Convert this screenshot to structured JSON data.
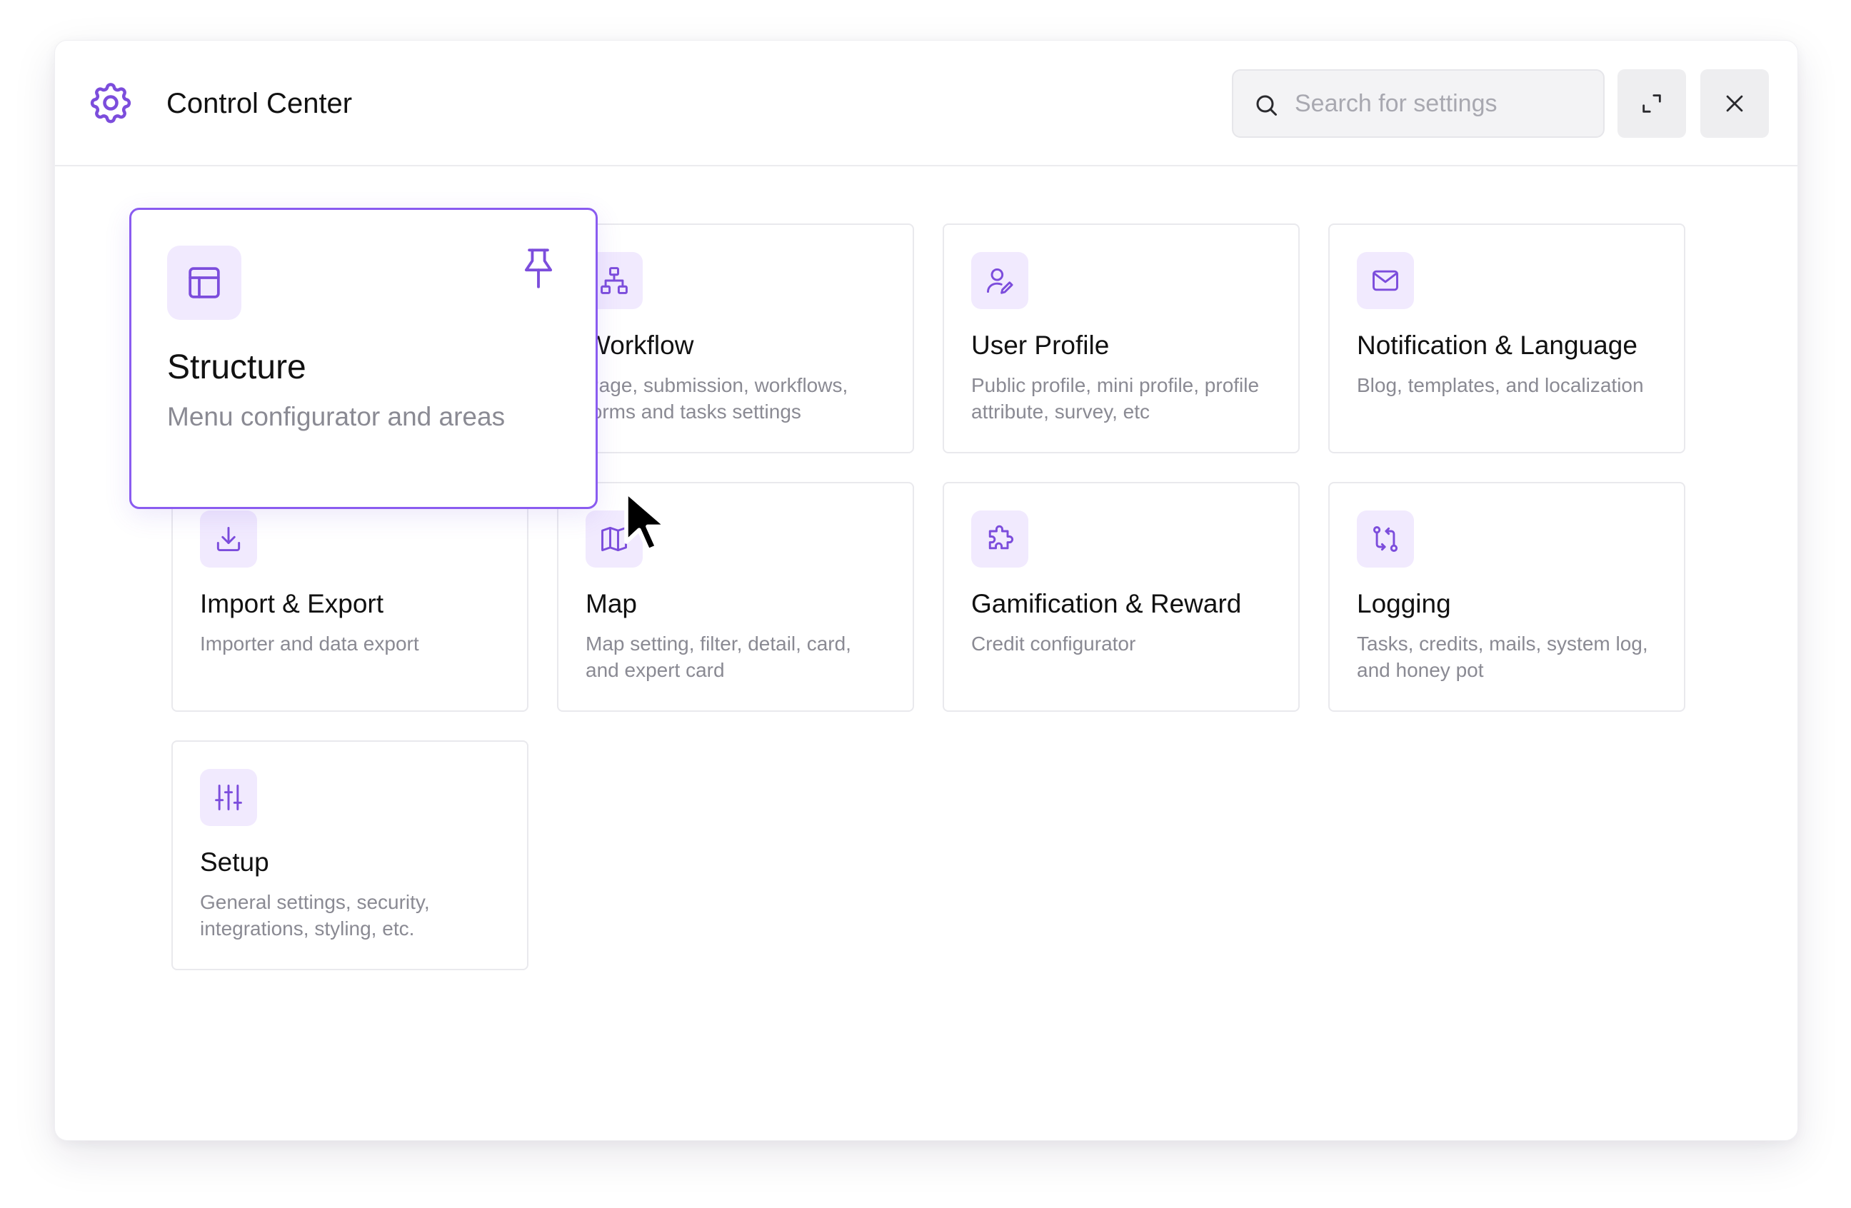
{
  "window": {
    "title": "Control Center",
    "app_icon": "gear-icon"
  },
  "header": {
    "search": {
      "placeholder": "Search for settings",
      "value": "",
      "icon": "search-icon"
    },
    "expand_icon": "expand-icon",
    "close_icon": "close-icon"
  },
  "colors": {
    "accent": "#7c4ddc",
    "icon_bg": "#f1eafe",
    "featured_border": "#8a5cf0",
    "title_text": "#111111",
    "desc_text": "#8a8a93"
  },
  "featured": {
    "title": "Structure",
    "description": "Menu configurator and areas",
    "icon": "layout-icon",
    "pin_icon": "pin-icon"
  },
  "cards": [
    {
      "title": "Workflow",
      "description": "Page, submission, workflows, forms and tasks settings",
      "icon": "sitemap-icon"
    },
    {
      "title": "User Profile",
      "description": "Public profile, mini profile, profile attribute, survey, etc",
      "icon": "user-edit-icon"
    },
    {
      "title": "Notification & Language",
      "description": "Blog, templates, and localization",
      "icon": "mail-icon"
    },
    {
      "title": "Import & Export",
      "description": "Importer and data export",
      "icon": "download-icon"
    },
    {
      "title": "Map",
      "description": "Map setting, filter, detail, card, and expert card",
      "icon": "map-icon"
    },
    {
      "title": "Gamification & Reward",
      "description": "Credit configurator",
      "icon": "puzzle-icon"
    },
    {
      "title": "Logging",
      "description": "Tasks, credits, mails, system log, and honey pot",
      "icon": "git-compare-icon"
    },
    {
      "title": "Setup",
      "description": "General settings, security, integrations, styling, etc.",
      "icon": "sliders-icon"
    }
  ]
}
